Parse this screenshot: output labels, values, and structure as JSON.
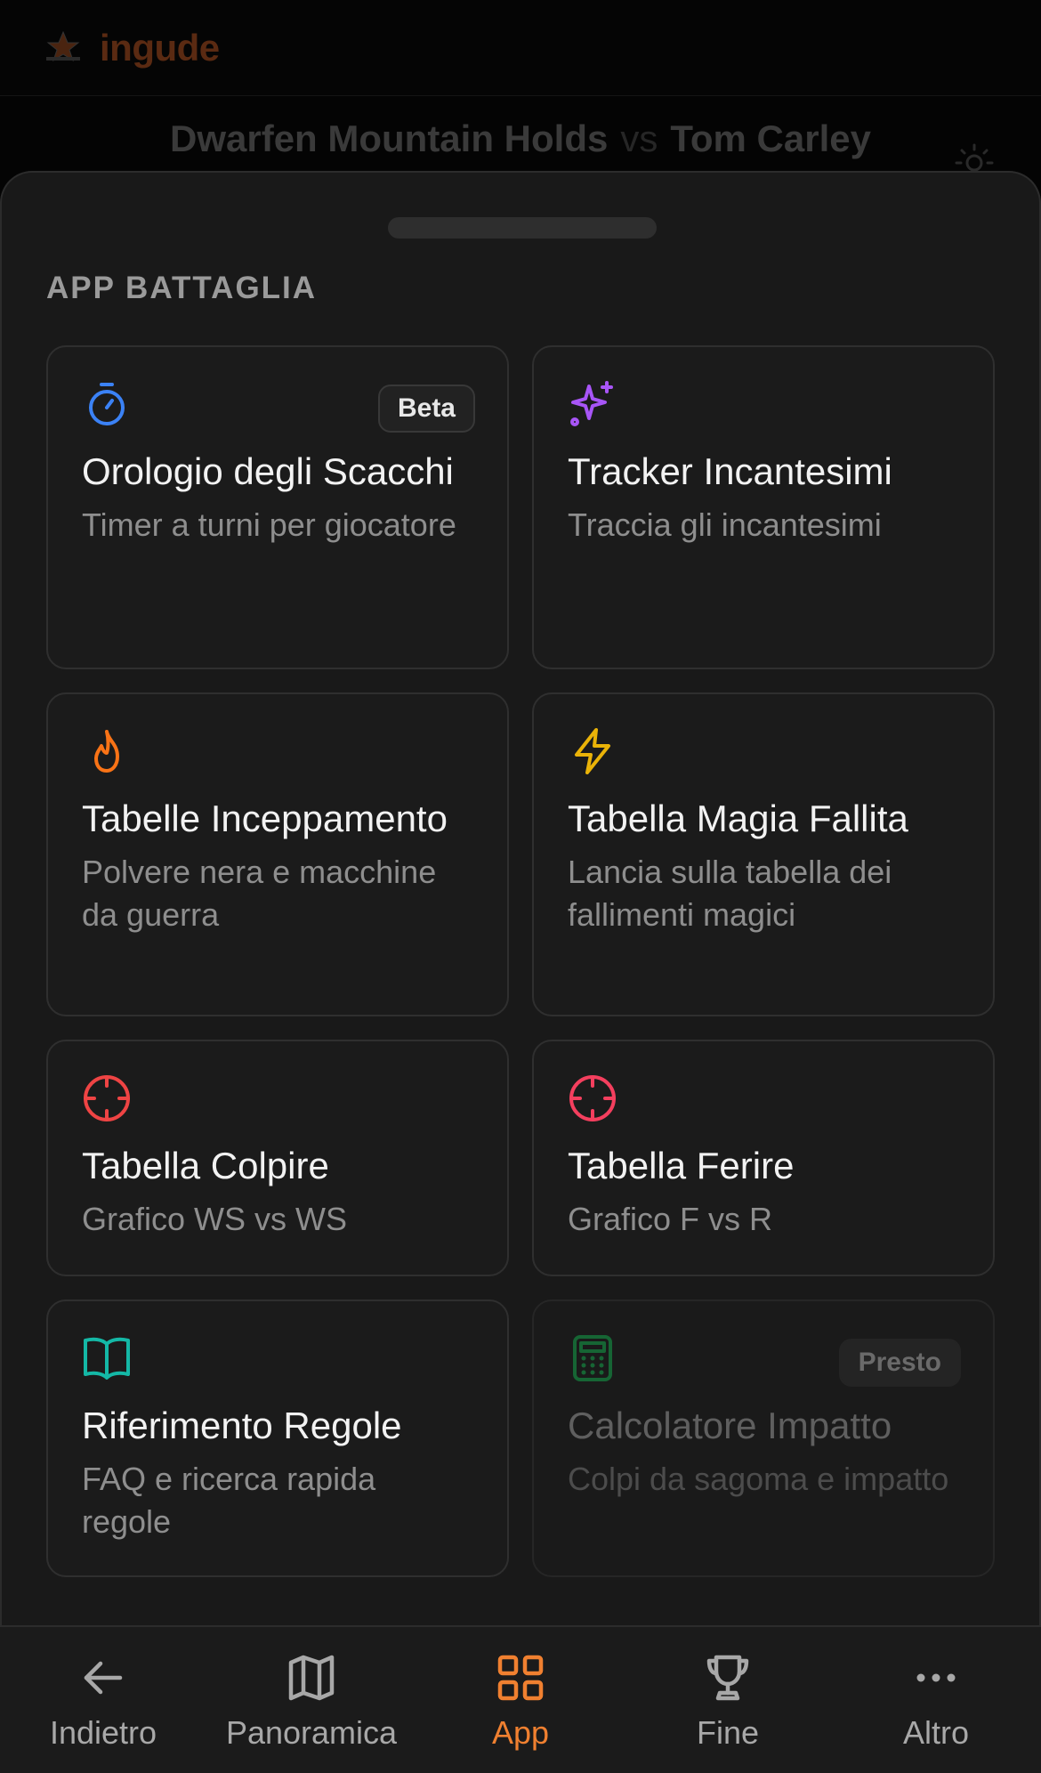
{
  "app": {
    "brand": "ingude"
  },
  "match": {
    "player1": "Dwarfen Mountain Holds",
    "vs": "vs",
    "player2": "Tom Carley"
  },
  "sheet": {
    "section_title": "APP BATTAGLIA"
  },
  "cards": [
    {
      "icon": "stopwatch-icon",
      "color": "#3b82f6",
      "title": "Orologio degli Scacchi",
      "desc": "Timer a turni per giocatore",
      "badge": "Beta"
    },
    {
      "icon": "sparkles-icon",
      "color": "#a855f7",
      "title": "Tracker Incantesimi",
      "desc": "Traccia gli incantesimi"
    },
    {
      "icon": "flame-icon",
      "color": "#f97316",
      "title": "Tabelle Inceppamento",
      "desc": "Polvere nera e macchine da guerra"
    },
    {
      "icon": "lightning-icon",
      "color": "#eab308",
      "title": "Tabella Magia Fallita",
      "desc": "Lancia sulla tabella dei fallimenti magici"
    },
    {
      "icon": "crosshair-icon",
      "color": "#ef4444",
      "title": "Tabella Colpire",
      "desc": "Grafico WS vs WS"
    },
    {
      "icon": "crosshair-icon",
      "color": "#f43f5e",
      "title": "Tabella Ferire",
      "desc": "Grafico F vs R"
    },
    {
      "icon": "book-icon",
      "color": "#14b8a6",
      "title": "Riferimento Regole",
      "desc": "FAQ e ricerca rapida regole"
    },
    {
      "icon": "calculator-icon",
      "color": "#166534",
      "title": "Calcolatore Impatto",
      "desc": "Colpi da sagoma e impatto",
      "badge": "Presto",
      "disabled": true
    }
  ],
  "nav": [
    {
      "icon": "arrow-left-icon",
      "label": "Indietro"
    },
    {
      "icon": "map-icon",
      "label": "Panoramica"
    },
    {
      "icon": "grid-icon",
      "label": "App",
      "active": true
    },
    {
      "icon": "trophy-icon",
      "label": "Fine"
    },
    {
      "icon": "more-horizontal-icon",
      "label": "Altro"
    }
  ],
  "colors": {
    "accent": "#f08030",
    "background": "#191919"
  }
}
